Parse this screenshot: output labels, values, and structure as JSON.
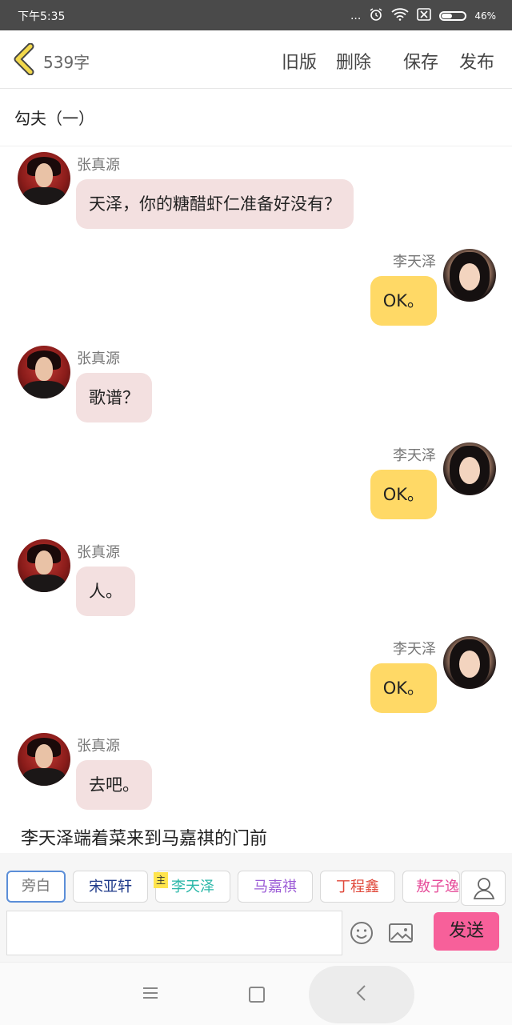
{
  "status_bar": {
    "time": "下午5:35",
    "signal_dots": "...",
    "battery_percent": "46%",
    "battery_level": 0.46
  },
  "header": {
    "word_count": "539字",
    "buttons": {
      "old_version": "旧版",
      "delete": "删除",
      "save": "保存",
      "publish": "发布"
    }
  },
  "story": {
    "title": "勾夫（一）"
  },
  "messages": [
    {
      "side": "left",
      "name": "张真源",
      "text": "天泽，你的糖醋虾仁准备好没有？"
    },
    {
      "side": "right",
      "name": "李天泽",
      "text": "OK。"
    },
    {
      "side": "left",
      "name": "张真源",
      "text": "歌谱？"
    },
    {
      "side": "right",
      "name": "李天泽",
      "text": "OK。"
    },
    {
      "side": "left",
      "name": "张真源",
      "text": "人。"
    },
    {
      "side": "right",
      "name": "李天泽",
      "text": "OK。"
    },
    {
      "side": "left",
      "name": "张真源",
      "text": "去吧。"
    }
  ],
  "narration": "李天泽端着菜来到马嘉祺的门前",
  "characters": [
    {
      "label": "旁白",
      "color": "#777777"
    },
    {
      "label": "宋亚轩",
      "color": "#1f3a8a"
    },
    {
      "label": "李天泽",
      "color": "#2bb7a8"
    },
    {
      "label": "马嘉祺",
      "color": "#9b5bd6"
    },
    {
      "label": "丁程鑫",
      "color": "#e0483a"
    },
    {
      "label": "敖子逸",
      "color": "#e64d9a"
    }
  ],
  "main_badge": "主",
  "composer": {
    "input_value": "",
    "send_label": "发送"
  },
  "colors": {
    "left_bubble": "#f3e0e0",
    "right_bubble": "#ffd966",
    "send_button": "#f7609a",
    "active_chip_border": "#5b8ed8",
    "back_arrow": "#f2c400"
  }
}
